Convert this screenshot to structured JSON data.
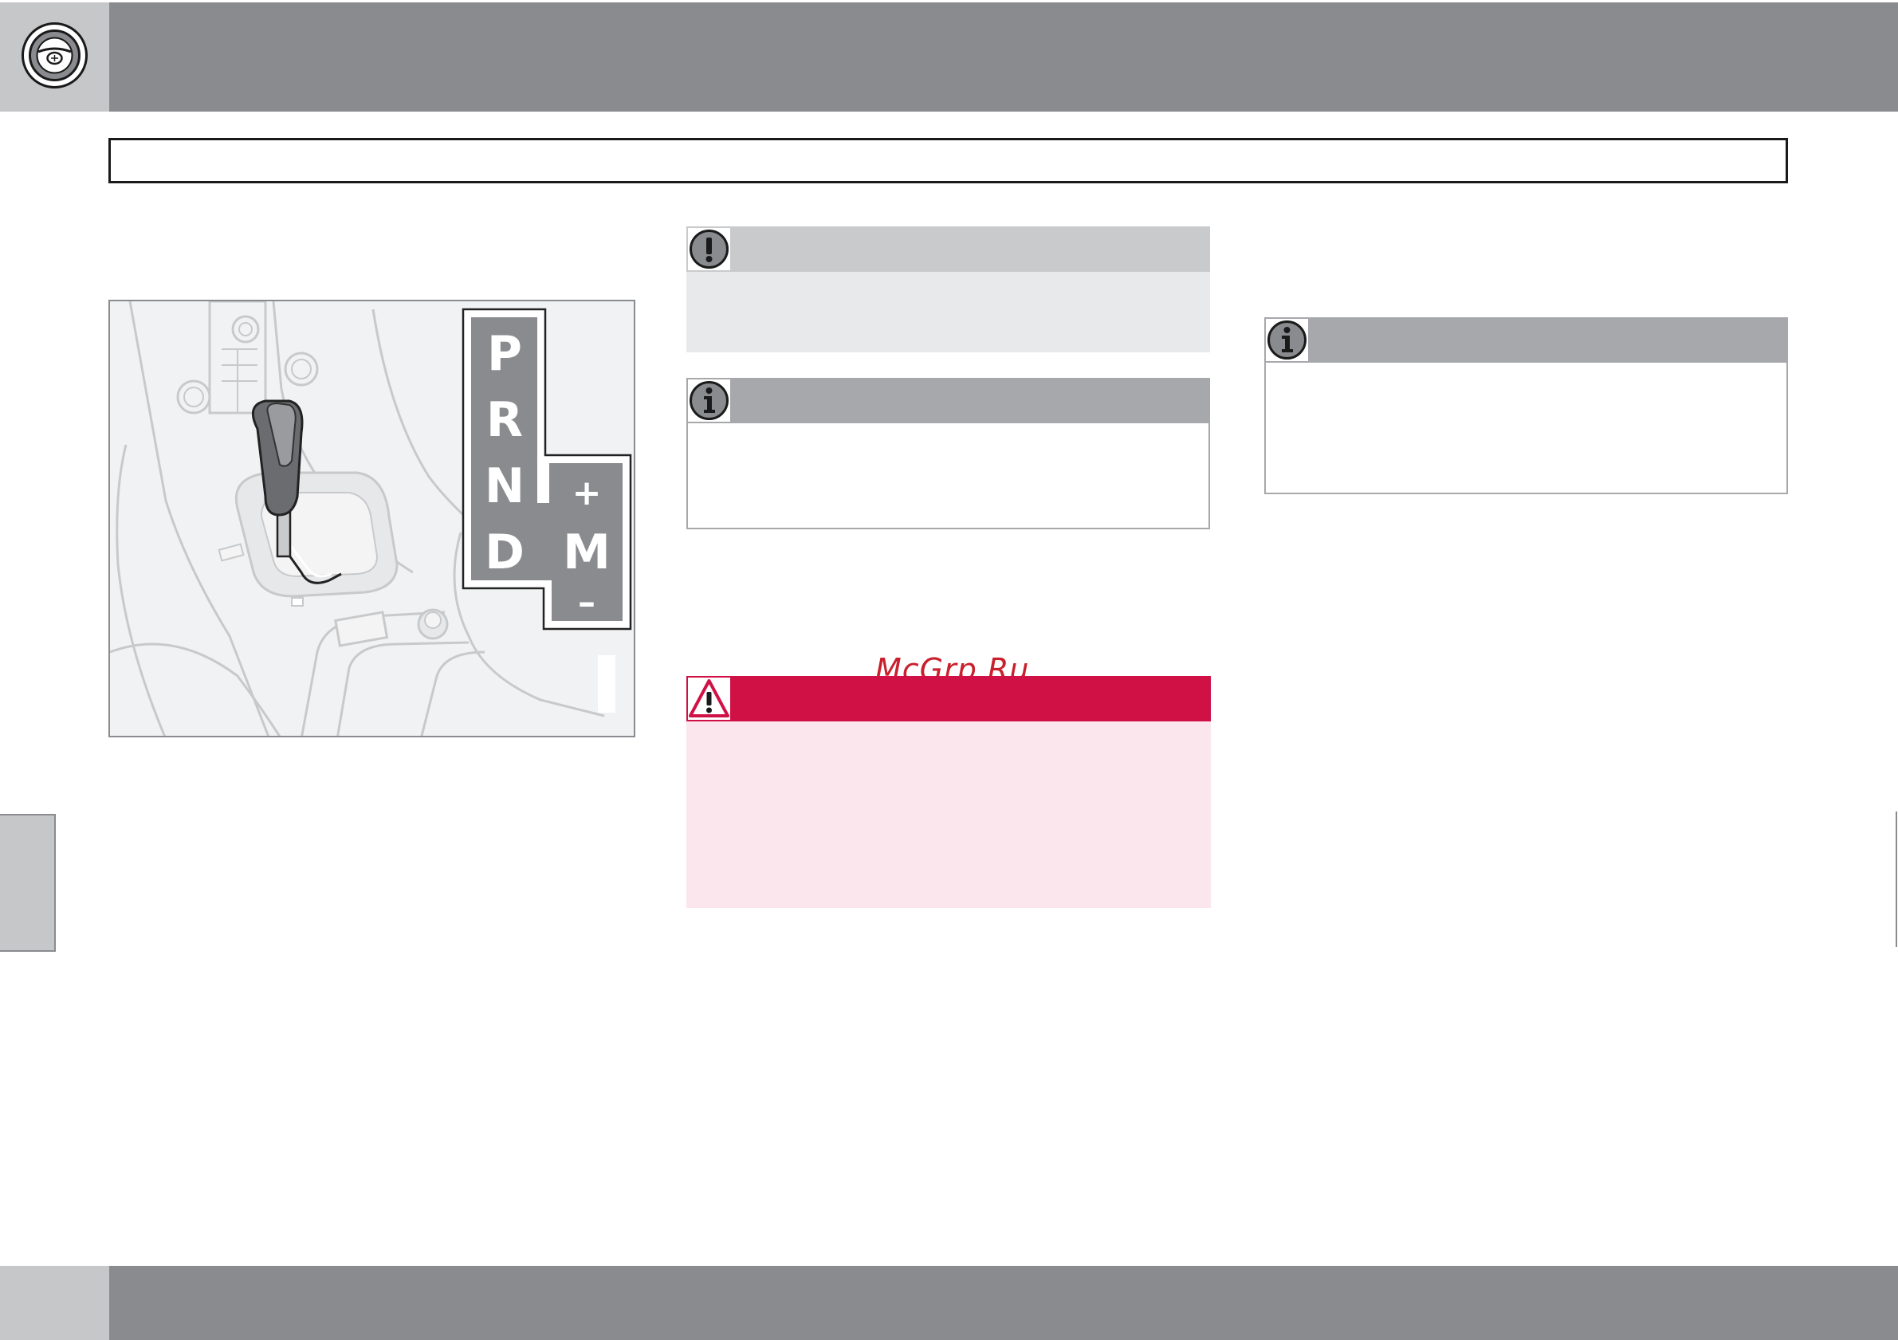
{
  "header": {
    "icon": "steering-wheel-icon",
    "background_color": "#8a8b8f",
    "icon_tab_color": "#c6c7c9"
  },
  "section_title": "",
  "figure": {
    "gear_positions_left": [
      "P",
      "R",
      "N",
      "D"
    ],
    "gear_positions_right": [
      "+",
      "M",
      "–"
    ]
  },
  "important_box": {
    "icon": "exclamation-icon",
    "title": "",
    "text": ""
  },
  "note_box_1": {
    "icon": "info-icon",
    "title": "",
    "text": ""
  },
  "warning_box": {
    "icon": "warning-triangle-icon",
    "title": "",
    "text": "",
    "color": "#cf1146"
  },
  "note_box_2": {
    "icon": "info-icon",
    "title": "",
    "text": ""
  },
  "watermark": "McGrp.Ru",
  "footer": {
    "background_color": "#8a8b8f"
  }
}
